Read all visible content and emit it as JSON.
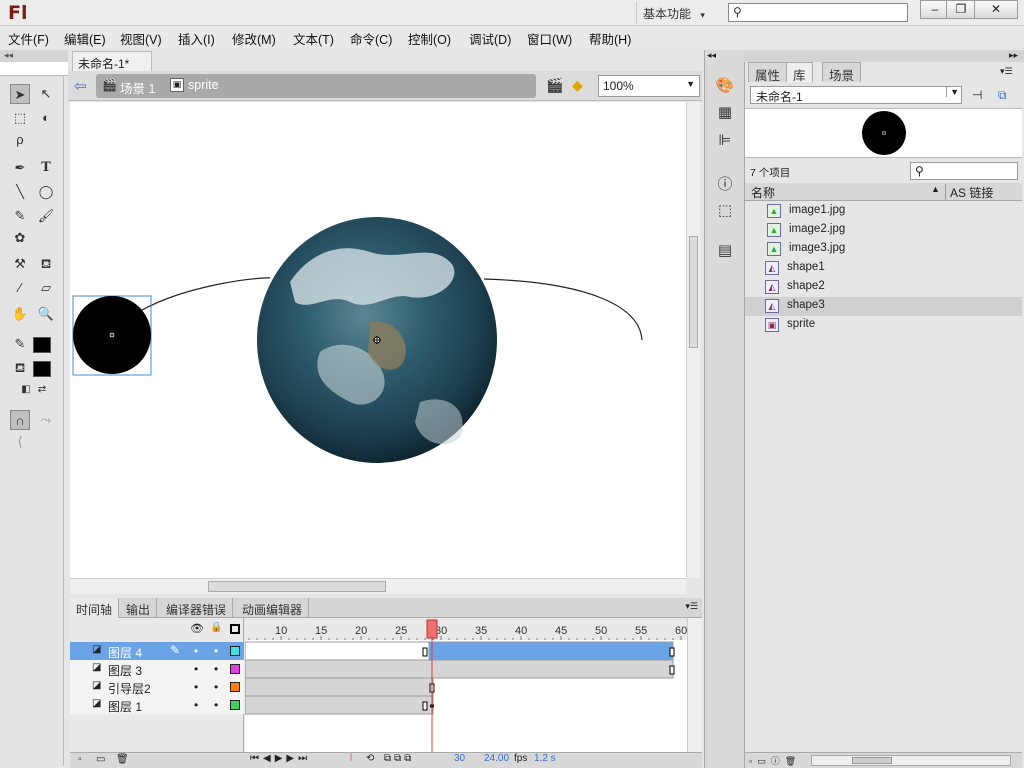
{
  "app": {
    "logo": "Fl",
    "workspace": "基本功能",
    "workspace_arrow": "▾"
  },
  "window_controls": {
    "minimize": "–",
    "restore": "❐",
    "close": "✕"
  },
  "menus": [
    "文件(F)",
    "编辑(E)",
    "视图(V)",
    "插入(I)",
    "修改(M)",
    "文本(T)",
    "命令(C)",
    "控制(O)",
    "调试(D)",
    "窗口(W)",
    "帮助(H)"
  ],
  "document": {
    "tab_title": "未命名-1*",
    "tab_close": "×"
  },
  "breadcrumb": {
    "scene": "场景 1",
    "symbol": "sprite"
  },
  "zoom": "100%",
  "timeline": {
    "tabs": [
      "时间轴",
      "输出",
      "编译器错误",
      "动画编辑器"
    ],
    "frame_numbers": [
      "10",
      "15",
      "20",
      "25",
      "30",
      "35",
      "40",
      "45",
      "50",
      "55",
      "60"
    ],
    "playhead_frame": 30,
    "layers": [
      {
        "name": "图层 4",
        "selected": true,
        "color": "#3fe0e0"
      },
      {
        "name": "图层 3",
        "selected": false,
        "color": "#e040e0"
      },
      {
        "name": "引导层2",
        "selected": false,
        "color": "#ff7f00"
      },
      {
        "name": "图层 1",
        "selected": false,
        "color": "#40d060"
      }
    ],
    "status": {
      "frame": "30",
      "fps": "24.00",
      "fps_unit": "fps",
      "time": "1.2 s"
    }
  },
  "right_panel": {
    "tabs": [
      "属性",
      "库",
      "场景"
    ],
    "active_tab": "库",
    "document_name": "未命名-1",
    "item_count": "7 个项目",
    "columns": {
      "name": "名称",
      "linkage": "AS 链接"
    },
    "items": [
      {
        "name": "image1.jpg",
        "kind": "bitmap"
      },
      {
        "name": "image2.jpg",
        "kind": "bitmap"
      },
      {
        "name": "image3.jpg",
        "kind": "bitmap"
      },
      {
        "name": "shape1",
        "kind": "graphic"
      },
      {
        "name": "shape2",
        "kind": "graphic"
      },
      {
        "name": "shape3",
        "kind": "graphic",
        "selected": true
      },
      {
        "name": "sprite",
        "kind": "movieclip"
      }
    ]
  },
  "colors": {
    "accent": "#6aa3e6",
    "playhead": "#e05050",
    "stage_bg": "#ffffff",
    "ui_bg": "#e6e6e6"
  }
}
